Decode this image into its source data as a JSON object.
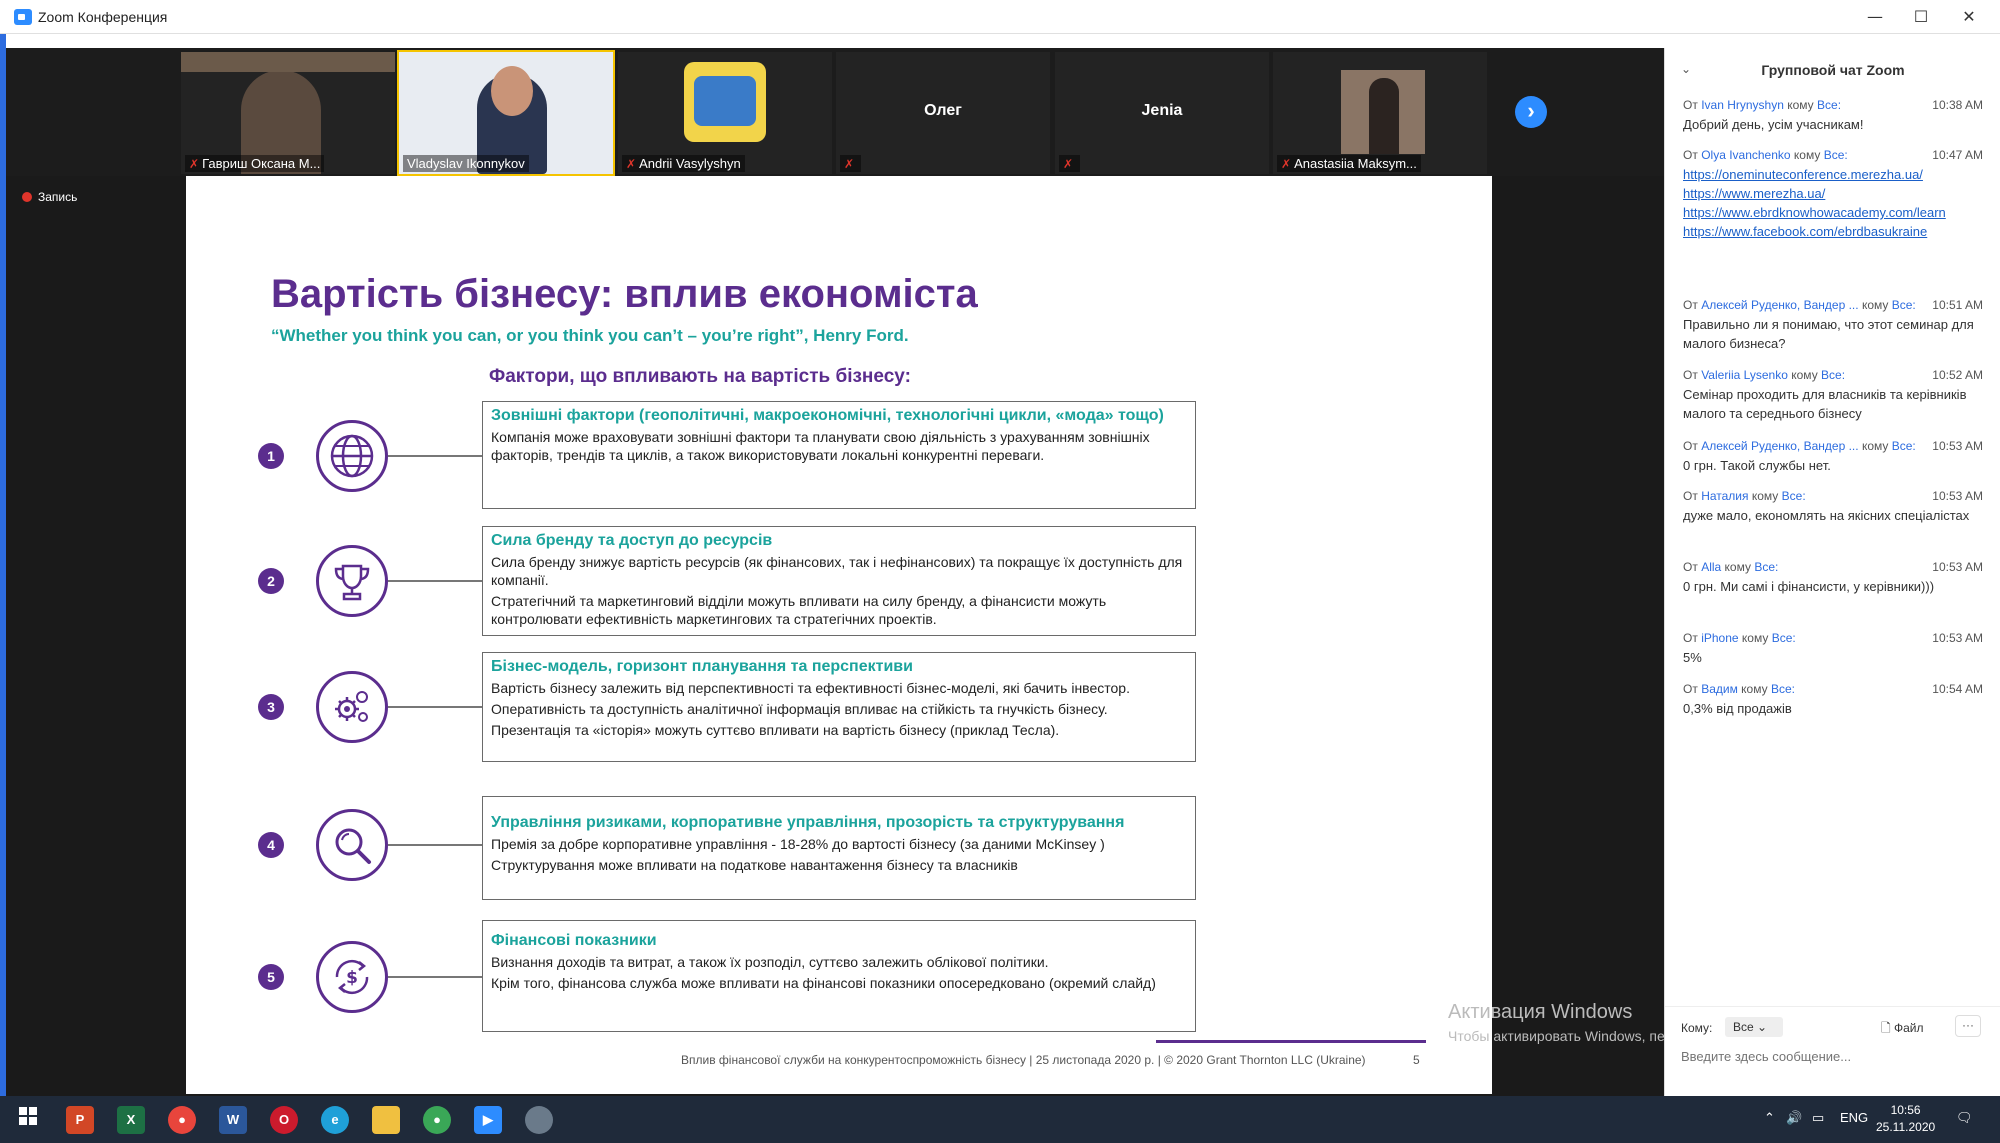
{
  "window": {
    "title": "Zoom Конференция",
    "minimize": "—",
    "maximize": "☐",
    "close": "✕"
  },
  "participants": [
    {
      "name": "Гавриш Оксана М...",
      "muted": true
    },
    {
      "name": "Vladyslav Ikonnykov",
      "muted": false,
      "active": true
    },
    {
      "name": "Andrii Vasylyshyn",
      "muted": true
    },
    {
      "name": "Олег",
      "muted": true
    },
    {
      "name": "Jenia",
      "muted": true
    },
    {
      "name": "Anastasiia Maksym...",
      "muted": true
    }
  ],
  "recording_label": "Запись",
  "slide": {
    "title": "Вартість бізнесу: вплив економіста",
    "quote": "“Whether you think you can, or you think you can’t – you’re right”, Henry Ford.",
    "subtitle": "Фактори, що впливають на вартість бізнесу:",
    "factors": [
      {
        "num": "1",
        "icon": "globe-icon",
        "heading": "Зовнішні фактори (геополітичні, макроекономічні, технологічні цикли, «мода» тощо)",
        "texts": [
          "Компанія може враховувати зовнішні фактори та планувати свою діяльність з урахуванням зовнішніх факторів, трендів та циклів, а також використовувати локальні конкурентні переваги."
        ]
      },
      {
        "num": "2",
        "icon": "trophy-icon",
        "heading": "Сила бренду та доступ до ресурсів",
        "texts": [
          "Сила бренду знижує вартість ресурсів (як фінансових, так і нефінансових) та покращує їх доступність для компанії.",
          "Стратегічний та маркетинговий відділи можуть впливати на силу бренду, а фінансисти можуть контролювати ефективність маркетингових та стратегічних проектів."
        ]
      },
      {
        "num": "3",
        "icon": "gears-icon",
        "heading": "Бізнес-модель, горизонт планування та перспективи",
        "texts": [
          "Вартість бізнесу залежить від перспективності та ефективності бізнес-моделі, які бачить інвестор.",
          "Оперативність та доступність аналітичної інформація впливає на стійкість та гнучкість бізнесу.",
          "Презентація та «історія» можуть суттєво впливати на вартість бізнесу (приклад Тесла)."
        ]
      },
      {
        "num": "4",
        "icon": "magnifier-icon",
        "heading": "Управління ризиками, корпоративне управління, прозорість та структурування",
        "texts": [
          "Премія за добре корпоративне управління - 18-28% до вартості бізнесу (за даними McKinsey )",
          "Структурування може впливати на податкове навантаження бізнесу та власників"
        ]
      },
      {
        "num": "5",
        "icon": "dollar-cycle-icon",
        "heading": "Фінансові показники",
        "texts": [
          "Визнання доходів та витрат, а також їх розподіл, суттєво залежить облікової політики.",
          "Крім того, фінансова служба може впливати на фінансові показники опосередковано (окремий слайд)"
        ]
      }
    ],
    "footer": "Вплив фінансової служби на конкурентоспроможність бізнесу | 25 листопада 2020 р. | © 2020 Grant Thornton LLC (Ukraine)",
    "page_number": "5"
  },
  "activation": {
    "title": "Активация Windows",
    "hint": "Чтобы активировать Windows, перейдите в раздел \"Параметры\"."
  },
  "chat": {
    "header": "Групповой чат Zoom",
    "messages": [
      {
        "from_label": "От",
        "from": "Ivan Hrynyshyn",
        "to_label": "кому",
        "to": "Все:",
        "time": "10:38 AM",
        "text": "Добрий день, усім учасникам!"
      },
      {
        "from_label": "От",
        "from": "Olya Ivanchenko",
        "to_label": "кому",
        "to": "Все:",
        "time": "10:47 AM",
        "links": [
          "https://oneminuteconference.merezha.ua/",
          "https://www.merezha.ua/",
          "https://www.ebrdknowhowacademy.com/learn",
          "https://www.facebook.com/ebrdbasukraine"
        ]
      },
      {
        "from_label": "От",
        "from": "Алексей Руденко, Вандер ...",
        "to_label": "кому",
        "to": "Все:",
        "time": "10:51 AM",
        "text": "Правильно ли я понимаю, что этот семинар для малого бизнеса?"
      },
      {
        "from_label": "От",
        "from": "Valeriia Lysenko",
        "to_label": "кому",
        "to": "Все:",
        "time": "10:52 AM",
        "text": "Семінар проходить для власників та керівників малого та середнього бізнесу"
      },
      {
        "from_label": "От",
        "from": "Алексей Руденко, Вандер ...",
        "to_label": "кому",
        "to": "Все:",
        "time": "10:53 AM",
        "text": "0 грн. Такой службы нет."
      },
      {
        "from_label": "От",
        "from": "Наталия",
        "to_label": "кому",
        "to": "Все:",
        "time": "10:53 AM",
        "text": "дуже мало, економлять на якісних спеціалістах"
      },
      {
        "from_label": "От",
        "from": "Alla",
        "to_label": "кому",
        "to": "Все:",
        "time": "10:53 AM",
        "text": "0 грн. Ми самі і фінансисти, у керівники)))"
      },
      {
        "from_label": "От",
        "from": "iPhone",
        "to_label": "кому",
        "to": "Все:",
        "time": "10:53 AM",
        "text": "5%"
      },
      {
        "from_label": "От",
        "from": "Вадим",
        "to_label": "кому",
        "to": "Все:",
        "time": "10:54 AM",
        "text": "0,3% від продажів"
      }
    ],
    "to_label": "Кому:",
    "to_value": "Все",
    "file_label": "Файл",
    "more_label": "···",
    "input_placeholder": "Введите здесь сообщение..."
  },
  "taskbar": {
    "apps": [
      "windows-start",
      "powerpoint",
      "excel",
      "chrome",
      "word",
      "opera",
      "edge",
      "file-explorer",
      "chrome-2",
      "zoom",
      "app-extra"
    ],
    "lang": "ENG",
    "time": "10:56",
    "date": "25.11.2020"
  }
}
